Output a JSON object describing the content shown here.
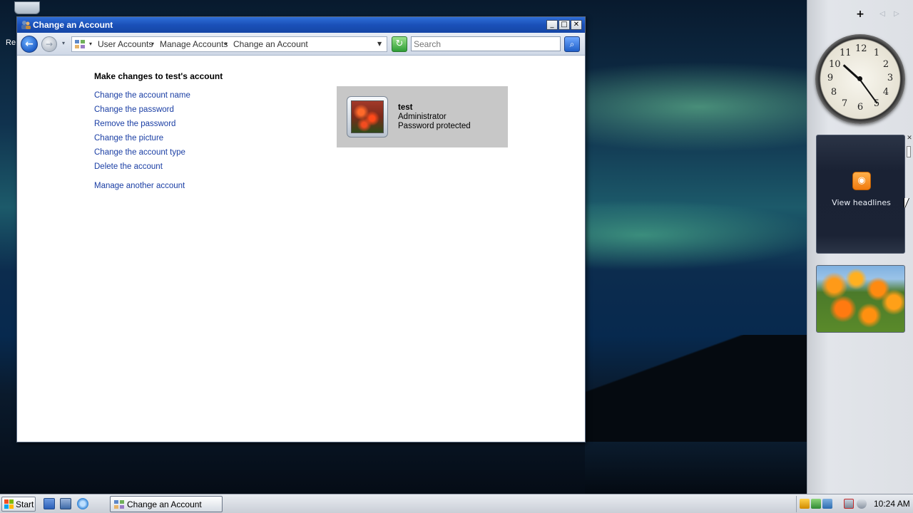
{
  "desktop": {
    "recycle_bin_label": "Re"
  },
  "window": {
    "title": "Change an Account",
    "controls": {
      "minimize": "_",
      "maximize": "□",
      "close": "✕"
    },
    "nav": {
      "back": "←",
      "forward": "→",
      "history": "▾"
    },
    "breadcrumb": [
      "User Accounts",
      "Manage Accounts",
      "Change an Account"
    ],
    "refresh": "↻",
    "search": {
      "placeholder": "Search",
      "button": "⌕"
    }
  },
  "content": {
    "heading": "Make changes to test's account",
    "tasks": [
      "Change the account name",
      "Change the password",
      "Remove the password",
      "Change the picture",
      "Change the account type",
      "Delete the account"
    ],
    "other_task": "Manage another account",
    "account": {
      "name": "test",
      "type": "Administrator",
      "status": "Password protected"
    }
  },
  "sidebar": {
    "add": "+",
    "prev": "◁",
    "next": "▷",
    "clock": {
      "numbers": [
        "12",
        "1",
        "2",
        "3",
        "4",
        "5",
        "6",
        "7",
        "8",
        "9",
        "10",
        "11"
      ],
      "time": "10:24"
    },
    "feeds": {
      "label": "View headlines",
      "close": "✕",
      "icon": "rss-icon"
    }
  },
  "taskbar": {
    "start_label": "Start",
    "quick_launch": [
      "show-desktop-icon",
      "switch-windows-icon",
      "internet-explorer-icon"
    ],
    "active_task": "Change an Account",
    "clock": "10:24 AM"
  },
  "colors": {
    "link": "#1a3ea4",
    "titlebar": "#1a50b8",
    "account_card": "#c7c7c7"
  }
}
